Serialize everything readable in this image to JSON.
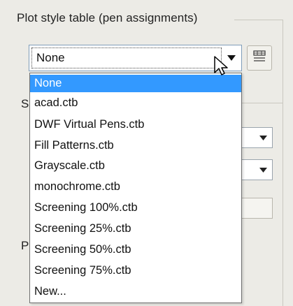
{
  "group": {
    "title": "Plot style table (pen assignments)"
  },
  "combo": {
    "value": "None"
  },
  "dropdown": {
    "options": [
      "None",
      "acad.ctb",
      "DWF Virtual Pens.ctb",
      "Fill Patterns.ctb",
      "Grayscale.ctb",
      "monochrome.ctb",
      "Screening 100%.ctb",
      "Screening 25%.ctb",
      "Screening 50%.ctb",
      "Screening 75%.ctb",
      "New..."
    ],
    "selected_index": 0
  },
  "background": {
    "label_sh": "Sh",
    "label_pl": "Pl"
  },
  "colors": {
    "highlight": "#3399ff",
    "dialog_bg": "#ecebe6",
    "combo_border": "#7f9db9"
  },
  "icons": {
    "combo_arrow": "chevron-down-icon",
    "edit_button": "table-edit-icon",
    "cursor": "mouse-cursor-icon"
  }
}
